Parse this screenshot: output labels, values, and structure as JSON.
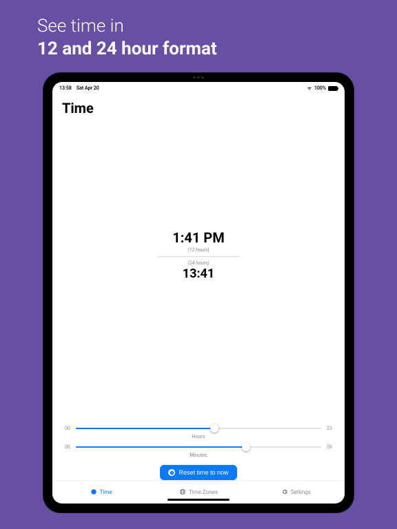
{
  "promo": {
    "line1": "See time in",
    "line2": "12 and 24 hour format"
  },
  "statusbar": {
    "time": "13:58",
    "date": "Sat Apr 20",
    "battery_pct": "100%"
  },
  "page": {
    "title": "Time"
  },
  "time_display": {
    "time_12h": "1:41 PM",
    "label_12h": "(12 hours)",
    "label_24h": "(24 hours)",
    "time_24h": "13:41"
  },
  "sliders": {
    "hours": {
      "min_label": "00",
      "max_label": "23",
      "label": "Hours",
      "value": 13,
      "max": 23
    },
    "minutes": {
      "min_label": "00",
      "max_label": "59",
      "label": "Minutes",
      "value": 41,
      "max": 59
    }
  },
  "reset_button": {
    "label": "Reset time to now"
  },
  "tabs": {
    "time": "Time",
    "timezones": "Time Zones",
    "settings": "Settings"
  },
  "colors": {
    "accent": "#0a7aff",
    "background": "#6750a4"
  }
}
